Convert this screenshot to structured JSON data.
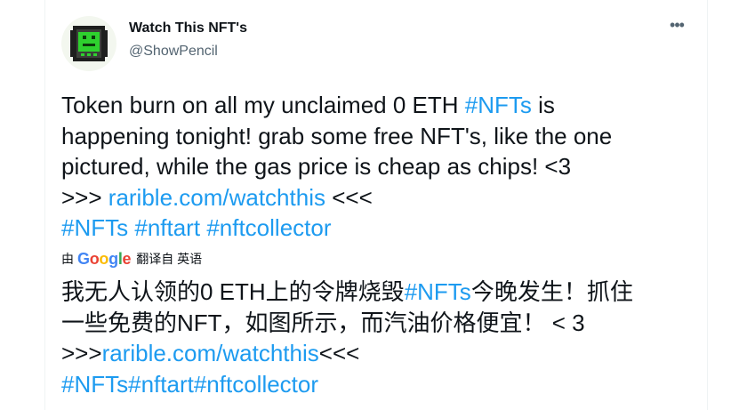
{
  "author": {
    "display_name": "Watch This NFT's",
    "handle": "@ShowPencil",
    "avatar_icon": "robot-avatar-icon",
    "more_label": "•••"
  },
  "tweet": {
    "lines": [
      [
        {
          "text": "Token burn on all my unclaimed 0 ETH ",
          "link": false
        },
        {
          "text": "#NFTs",
          "link": true
        },
        {
          "text": " is",
          "link": false
        }
      ],
      [
        {
          "text": "happening tonight! grab some free NFT's, like the one",
          "link": false
        }
      ],
      [
        {
          "text": "pictured, while the gas price is cheap as chips! <3",
          "link": false
        }
      ],
      [
        {
          "text": ">>> ",
          "link": false
        },
        {
          "text": "rarible.com/watchthis",
          "link": true
        },
        {
          "text": " <<<",
          "link": false
        }
      ],
      [
        {
          "text": "#NFTs",
          "link": true
        },
        {
          "text": " ",
          "link": false
        },
        {
          "text": "#nftart",
          "link": true
        },
        {
          "text": " ",
          "link": false
        },
        {
          "text": "#nftcollector",
          "link": true
        }
      ]
    ]
  },
  "translation": {
    "by_label": "由",
    "provider": "Google",
    "translated_from_label": "翻译自 英语",
    "lines": [
      [
        {
          "text": "我无人认领的0 ETH上的令牌烧毁",
          "link": false
        },
        {
          "text": "#NFTs",
          "link": true
        },
        {
          "text": "今晚发生！抓住",
          "link": false
        }
      ],
      [
        {
          "text": "一些免费的NFT，如图所示，而汽油价格便宜！ < 3",
          "link": false
        }
      ],
      [
        {
          "text": ">>>",
          "link": false
        },
        {
          "text": "rarible.com/watchthis",
          "link": true
        },
        {
          "text": "<<<",
          "link": false
        }
      ],
      [
        {
          "text": "#NFTs",
          "link": true
        },
        {
          "text": "#nftart",
          "link": true
        },
        {
          "text": "#nftcollector",
          "link": true
        }
      ]
    ]
  },
  "colors": {
    "link": "#1d9bf0",
    "text": "#0f1419",
    "muted": "#536471"
  }
}
